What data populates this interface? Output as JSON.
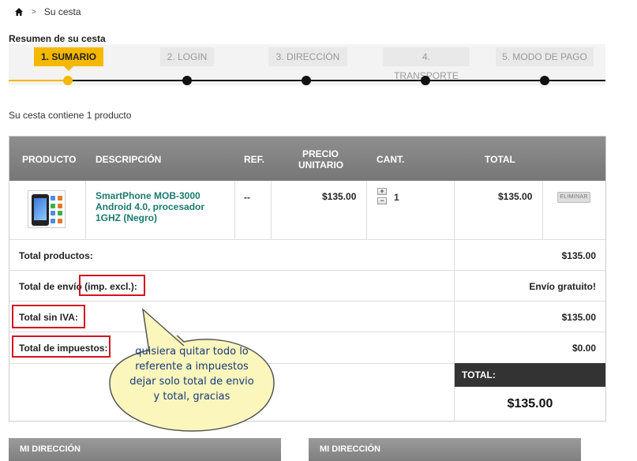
{
  "breadcrumb": {
    "current": "Su cesta",
    "separator": ">"
  },
  "summary_title": "Resumen de su cesta",
  "steps": [
    {
      "label": "1. SUMARIO",
      "active": true
    },
    {
      "label": "2. LOGIN",
      "active": false
    },
    {
      "label": "3. DIRECCIÓN",
      "active": false
    },
    {
      "label": "4. TRANSPORTE",
      "active": false
    },
    {
      "label": "5. MODO DE PAGO",
      "active": false
    }
  ],
  "cart_count_text": "Su cesta contiene 1 producto",
  "table": {
    "headers": {
      "product": "PRODUCTO",
      "description": "DESCRIPCIÓN",
      "ref": "REF.",
      "unit_price_1": "PRECIO",
      "unit_price_2": "UNITARIO",
      "qty": "CANT.",
      "total": "TOTAL"
    },
    "item": {
      "description": "SmartPhone MOB-3000 Android 4.0, procesador 1GHZ (Negro)",
      "ref": "--",
      "unit_price": "$135.00",
      "qty": "1",
      "qty_plus": "+",
      "qty_minus": "−",
      "total": "$135.00",
      "delete_label": "ELIMINAR"
    }
  },
  "totals": {
    "products_label": "Total productos:",
    "products_value": "$135.00",
    "shipping_label": "Total de envío",
    "shipping_label_suffix": "(imp. excl.):",
    "shipping_value": "Envío gratuito!",
    "no_vat_label": "Total sin IVA:",
    "no_vat_value": "$135.00",
    "taxes_label": "Total de impuestos:",
    "taxes_value": "$0.00",
    "grand_total_label": "TOTAL:",
    "grand_total_value": "$135.00"
  },
  "annotation": {
    "line1": "quisiera quitar todo lo",
    "line2": "referente a impuestos",
    "line3": "dejar solo total de envio",
    "line4": "y total, gracias",
    "fill_color": "#fbf6bc",
    "highlight_color": "#d2141e"
  },
  "address_headers": [
    "MI DIRECCIÓN",
    "MI DIRECCIÓN"
  ],
  "colors": {
    "accent": "#f5b800",
    "link_green": "#1a7a6e",
    "header_gray": "#808080"
  }
}
